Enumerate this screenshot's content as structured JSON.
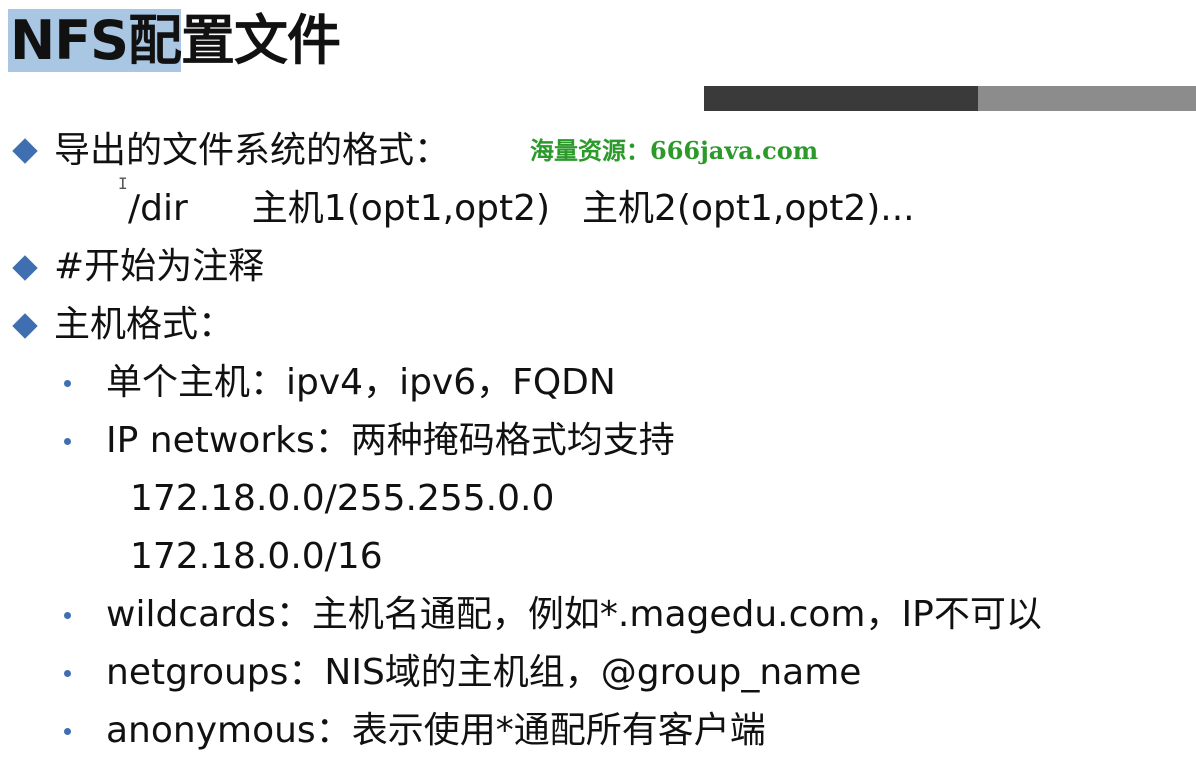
{
  "title": {
    "highlight": "NFS配",
    "rest": "置文件"
  },
  "watermark": "海量资源：666java.com",
  "export_format": {
    "label": "导出的文件系统的格式：",
    "syntax": {
      "dir": "/dir",
      "host1": "主机1(opt1,opt2)",
      "host2": "主机2(opt1,opt2)..."
    }
  },
  "comment_rule": "#开始为注释",
  "host_format": {
    "label": "主机格式：",
    "items": [
      {
        "text": "单个主机：ipv4，ipv6，FQDN"
      },
      {
        "text": "IP networks：两种掩码格式均支持"
      },
      {
        "text": "wildcards：主机名通配，例如*.magedu.com，IP不可以"
      },
      {
        "text": "netgroups：NIS域的主机组，@group_name"
      },
      {
        "text": "anonymous：表示使用*通配所有客户端"
      }
    ],
    "network_examples": [
      "172.18.0.0/255.255.0.0",
      "172.18.0.0/16"
    ]
  },
  "colors": {
    "bullet": "#3f6fb0",
    "title_highlight": "#a9c6e2",
    "watermark": "#2b9a2b",
    "bar_dark": "#3a3a3a",
    "bar_light": "#8c8c8c"
  },
  "icons": {
    "main_bullet": "diamond-bullet-icon",
    "sub_bullet": "dot-bullet-icon",
    "cursor": "text-cursor-icon"
  }
}
